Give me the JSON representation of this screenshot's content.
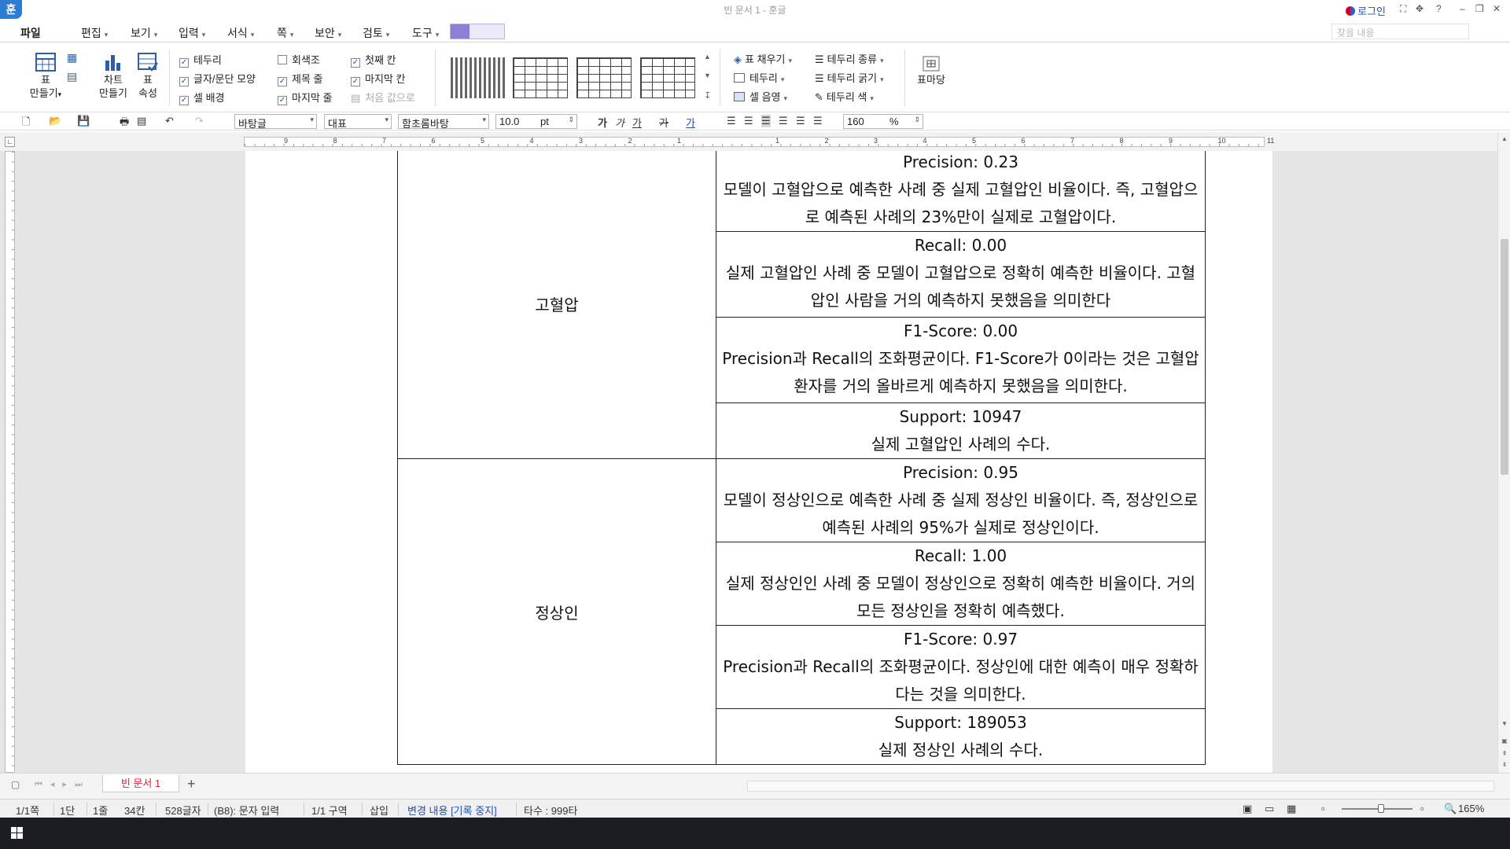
{
  "titlebar": {
    "logo": "훈",
    "title": "빈 문서 1 - 훈글",
    "login": "로그인",
    "help": "?"
  },
  "menubar": {
    "file": "파일",
    "items": [
      "편집",
      "보기",
      "입력",
      "서식",
      "쪽",
      "보안",
      "검토",
      "도구"
    ],
    "find_placeholder": "찾을 내용"
  },
  "ribbon": {
    "table_make": [
      "표",
      "만들기"
    ],
    "chart_make": [
      "차트",
      "만들기"
    ],
    "table_props": [
      "표",
      "속성"
    ],
    "checks_col1": [
      {
        "label": "테두리",
        "checked": true
      },
      {
        "label": "글자/문단 모양",
        "checked": true
      },
      {
        "label": "셀 배경",
        "checked": true
      }
    ],
    "checks_col2": [
      {
        "label": "회색조",
        "checked": false
      },
      {
        "label": "제목 줄",
        "checked": true
      },
      {
        "label": "마지막 줄",
        "checked": true
      }
    ],
    "checks_col3": [
      {
        "label": "첫째 칸",
        "checked": true
      },
      {
        "label": "마지막 칸",
        "checked": true
      },
      {
        "label": "처음 값으로",
        "checked": false
      }
    ],
    "right_col1": [
      "표 채우기",
      "테두리",
      "셀 음영"
    ],
    "right_col2": [
      "테두리 종류",
      "테두리 굵기",
      "테두리 색"
    ],
    "table_yard": "표마당"
  },
  "toolbar2": {
    "style": "바탕글",
    "lang": "대표",
    "font": "함초롬바탕",
    "size": "10.0",
    "unit": "pt",
    "zoom": "160",
    "zoom_unit": "%"
  },
  "ruler_numbers": [
    "9",
    "8",
    "7",
    "6",
    "5",
    "4",
    "3",
    "2",
    "1",
    "",
    "1",
    "2",
    "3",
    "4",
    "5",
    "6",
    "7",
    "8",
    "9",
    "10",
    "11"
  ],
  "table": [
    {
      "category": "고혈압",
      "metrics": [
        {
          "title": "Precision: 0.23",
          "desc": "모델이 고혈압으로 예측한 사례 중 실제 고혈압인 비율이다. 즉, 고혈압으로 예측된 사례의 23%만이 실제로 고혈압이다."
        },
        {
          "title": "Recall: 0.00",
          "desc": "실제 고혈압인 사례 중 모델이 고혈압으로 정확히 예측한 비율이다. 고혈압인 사람을 거의 예측하지 못했음을 의미한다"
        },
        {
          "title": "F1-Score: 0.00",
          "desc": "Precision과 Recall의 조화평균이다. F1-Score가 0이라는 것은 고혈압 환자를 거의 올바르게 예측하지 못했음을 의미한다."
        },
        {
          "title": "Support: 10947",
          "desc": "실제 고혈압인 사례의 수다."
        }
      ]
    },
    {
      "category": "정상인",
      "metrics": [
        {
          "title": "Precision: 0.95",
          "desc": "모델이 정상인으로 예측한 사례 중 실제 정상인 비율이다. 즉, 정상인으로 예측된 사례의 95%가 실제로 정상인이다."
        },
        {
          "title": "Recall: 1.00",
          "desc": "실제 정상인인 사례 중 모델이 정상인으로 정확히 예측한 비율이다. 거의 모든 정상인을 정확히 예측했다."
        },
        {
          "title": "F1-Score: 0.97",
          "desc": "Precision과 Recall의 조화평균이다. 정상인에 대한 예측이 매우 정확하다는 것을 의미한다."
        },
        {
          "title": "Support: 189053",
          "desc": "실제 정상인 사례의 수다."
        }
      ]
    }
  ],
  "tabs": {
    "doc": "빈 문서 1",
    "add": "+"
  },
  "statusbar": {
    "page": "1/1쪽",
    "section": "1단",
    "line": "1줄",
    "col": "34칸",
    "chars": "528글자",
    "mode": "(B8): 문자 입력",
    "area": "1/1 구역",
    "insert": "삽입",
    "track": "변경 내용 [기록 중지]",
    "typing": "타수 : 999타",
    "zoom": "165%"
  }
}
